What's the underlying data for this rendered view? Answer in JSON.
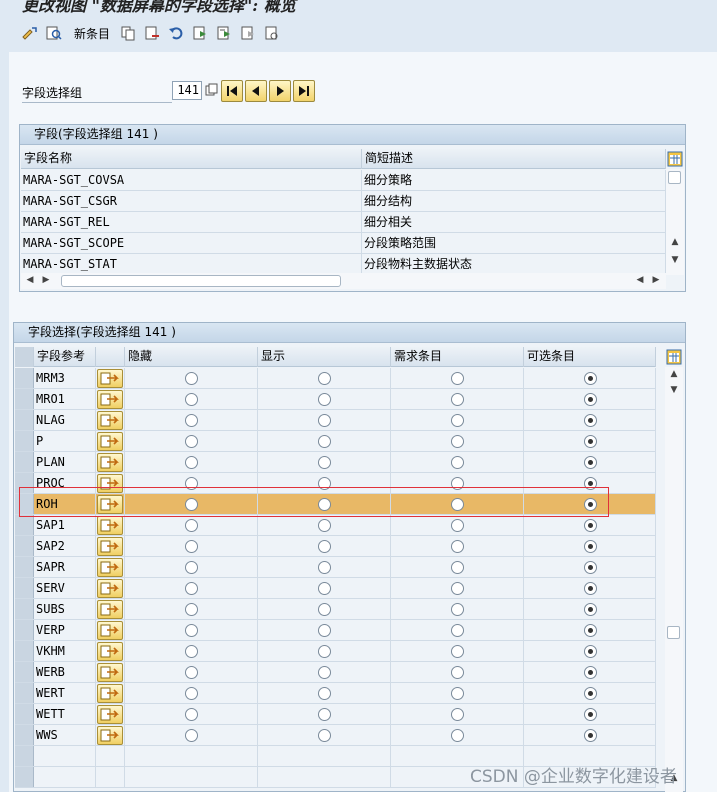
{
  "window": {
    "title": "更改视图 \"数据屏幕的字段选择\": 概览"
  },
  "toolbar": {
    "new_entries_label": "新条目"
  },
  "field_group": {
    "label": "字段选择组",
    "value": "141"
  },
  "fields_panel": {
    "title": "字段(字段选择组 141 )",
    "columns": [
      "字段名称",
      "简短描述"
    ],
    "rows": [
      {
        "name": "MARA-SGT_COVSA",
        "desc": "细分策略"
      },
      {
        "name": "MARA-SGT_CSGR",
        "desc": "细分结构"
      },
      {
        "name": "MARA-SGT_REL",
        "desc": "细分相关"
      },
      {
        "name": "MARA-SGT_SCOPE",
        "desc": "分段策略范围"
      },
      {
        "name": "MARA-SGT_STAT",
        "desc": "分段物料主数据状态"
      }
    ]
  },
  "selection_panel": {
    "title": "字段选择(字段选择组 141 )",
    "columns": [
      "字段参考",
      "隐藏",
      "显示",
      "需求条目",
      "可选条目"
    ],
    "selected_row": "ROH",
    "rows": [
      {
        "ref": "MRM3",
        "option": "可选条目"
      },
      {
        "ref": "MRO1",
        "option": "可选条目"
      },
      {
        "ref": "NLAG",
        "option": "可选条目"
      },
      {
        "ref": "P",
        "option": "可选条目"
      },
      {
        "ref": "PLAN",
        "option": "可选条目"
      },
      {
        "ref": "PROC",
        "option": "可选条目"
      },
      {
        "ref": "ROH",
        "option": "可选条目"
      },
      {
        "ref": "SAP1",
        "option": "可选条目"
      },
      {
        "ref": "SAP2",
        "option": "可选条目"
      },
      {
        "ref": "SAPR",
        "option": "可选条目"
      },
      {
        "ref": "SERV",
        "option": "可选条目"
      },
      {
        "ref": "SUBS",
        "option": "可选条目"
      },
      {
        "ref": "VERP",
        "option": "可选条目"
      },
      {
        "ref": "VKHM",
        "option": "可选条目"
      },
      {
        "ref": "WERB",
        "option": "可选条目"
      },
      {
        "ref": "WERT",
        "option": "可选条目"
      },
      {
        "ref": "WETT",
        "option": "可选条目"
      },
      {
        "ref": "WWS",
        "option": "可选条目"
      }
    ]
  },
  "watermark": "CSDN @企业数字化建设者",
  "colors": {
    "highlight_row": "#e8b866",
    "highlight_box": "#e0313a",
    "panel_header": "#c4d6e8"
  }
}
